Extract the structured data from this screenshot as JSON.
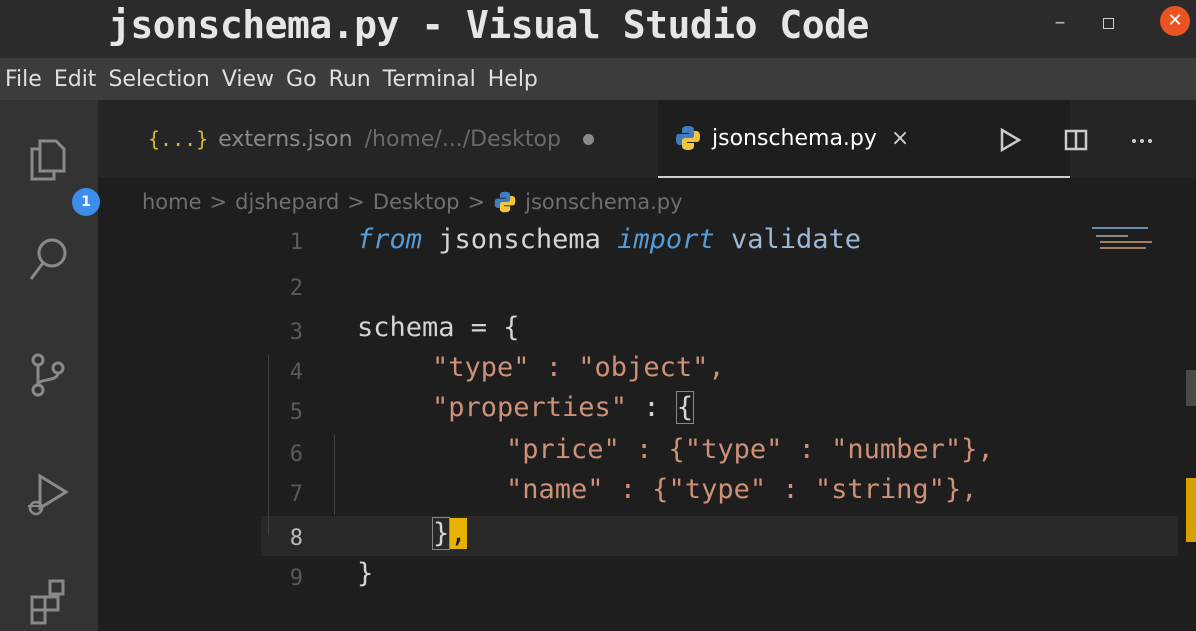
{
  "window": {
    "title": "jsonschema.py - Visual Studio Code",
    "minimize_glyph": "–",
    "close_glyph": "✕"
  },
  "menu": [
    "File",
    "Edit",
    "Selection",
    "View",
    "Go",
    "Run",
    "Terminal",
    "Help"
  ],
  "activity_bar": {
    "items": [
      "explorer-icon",
      "search-icon",
      "source-control-icon",
      "run-debug-icon",
      "extensions-icon"
    ],
    "explorer_badge": "1"
  },
  "tabs": [
    {
      "icon": "{...}",
      "name": "externs.json",
      "path": "/home/.../Desktop",
      "modified": true,
      "active": false
    },
    {
      "icon": "python-icon",
      "name": "jsonschema.py",
      "close": "×",
      "active": true
    }
  ],
  "breadcrumb": [
    "home",
    "djshepard",
    "Desktop",
    "jsonschema.py"
  ],
  "breadcrumb_sep": ">",
  "editor": {
    "line_numbers": [
      "1",
      "2",
      "3",
      "4",
      "5",
      "6",
      "7",
      "8",
      "9"
    ],
    "current_line": "8",
    "code": {
      "l1_from": "from",
      "l1_module": "jsonschema",
      "l1_import": "import",
      "l1_name": "validate",
      "l3": "schema = {",
      "l4": "\"type\" : \"object\",",
      "l5_key": "\"properties\"",
      "l5_colon": " : ",
      "l5_brace": "{",
      "l6": "\"price\" : {\"type\" : \"number\"},",
      "l7": "\"name\" : {\"type\" : \"string\"},",
      "l8_brace": "}",
      "l8_comma": ",",
      "l9": "}"
    }
  },
  "colors": {
    "keyword": "#569cd6",
    "string": "#ce9178",
    "accent_close": "#e95420",
    "badge": "#3b8eea"
  }
}
